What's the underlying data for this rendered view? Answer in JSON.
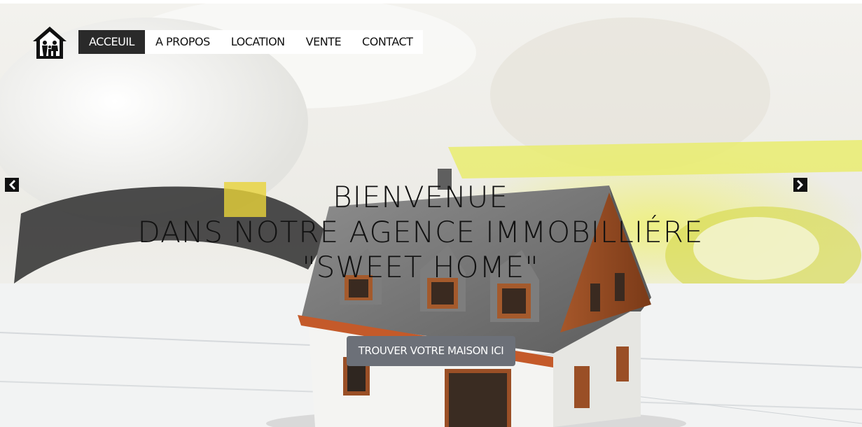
{
  "nav": {
    "items": [
      {
        "label": "ACCEUIL",
        "active": true
      },
      {
        "label": "A PROPOS",
        "active": false
      },
      {
        "label": "LOCATION",
        "active": false
      },
      {
        "label": "VENTE",
        "active": false
      },
      {
        "label": "CONTACT",
        "active": false
      }
    ]
  },
  "hero": {
    "line1": "BIENVENUE",
    "line2": "DANS NOTRE AGENCE IMMOBILLIÉRE",
    "line3": "\"SWEET HOME\"",
    "cta_label": "TROUVER VOTRE MAISON ICI"
  },
  "icons": {
    "logo": "house-family-icon",
    "prev": "chevron-left-icon",
    "next": "chevron-right-icon"
  },
  "colors": {
    "nav_active_bg": "#2a2a2a",
    "cta_bg": "#6c7078",
    "text": "#111111"
  }
}
